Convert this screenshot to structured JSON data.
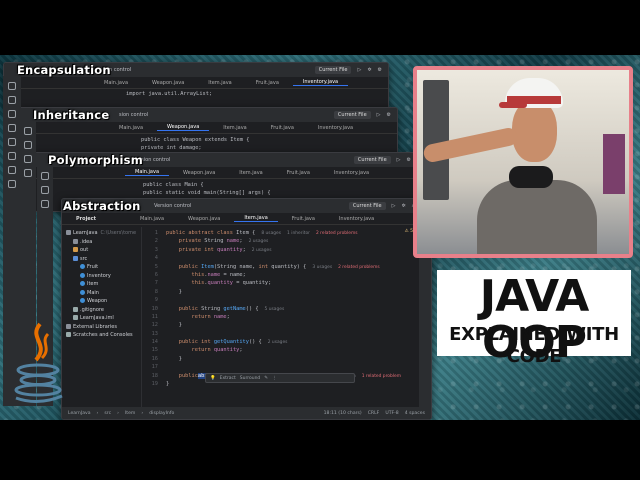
{
  "windows": [
    {
      "title": "Encapsulation",
      "version_control": "on control",
      "current_file": "Current File",
      "tabs": [
        "Main.java",
        "Weapon.java",
        "Item.java",
        "Fruit.java",
        "Inventory.java"
      ],
      "active_tab": 4,
      "code": [
        "import java.util.ArrayList;"
      ]
    },
    {
      "title": "Inheritance",
      "version_control": "sion control",
      "current_file": "Current File",
      "tabs": [
        "Main.java",
        "Weapon.java",
        "Item.java",
        "Fruit.java",
        "Inventory.java"
      ],
      "active_tab": 1,
      "code": [
        "public class Weapon extends Item {",
        "    private int damage;"
      ]
    },
    {
      "title": "Polymorphism",
      "version_control": "Version control",
      "current_file": "Current File",
      "tabs": [
        "Main.java",
        "Weapon.java",
        "Item.java",
        "Fruit.java",
        "Inventory.java"
      ],
      "active_tab": 0,
      "code": [
        "public class Main {",
        "    public static void main(String[] args) {"
      ]
    }
  ],
  "main_ide": {
    "title": "Abstraction",
    "project_label": "Project",
    "version_control": "Version control",
    "current_file": "Current File",
    "tabs": [
      "Main.java",
      "Weapon.java",
      "Item.java",
      "Fruit.java",
      "Inventory.java"
    ],
    "active_tab": 2,
    "tree": [
      {
        "label": "LearnJava",
        "suffix": "C:\\Users\\tome",
        "indent": 0,
        "icon": "folder"
      },
      {
        "label": ".idea",
        "indent": 1,
        "icon": "folder"
      },
      {
        "label": "out",
        "indent": 1,
        "icon": "folder orange"
      },
      {
        "label": "src",
        "indent": 1,
        "icon": "folder blue"
      },
      {
        "label": "Fruit",
        "indent": 2,
        "icon": "cls"
      },
      {
        "label": "Inventory",
        "indent": 2,
        "icon": "cls"
      },
      {
        "label": "Item",
        "indent": 2,
        "icon": "cls"
      },
      {
        "label": "Main",
        "indent": 2,
        "icon": "cls"
      },
      {
        "label": "Weapon",
        "indent": 2,
        "icon": "cls"
      },
      {
        "label": ".gitignore",
        "indent": 1,
        "icon": "file"
      },
      {
        "label": "LearnJava.iml",
        "indent": 1,
        "icon": "file"
      },
      {
        "label": "External Libraries",
        "indent": 0,
        "icon": "folder"
      },
      {
        "label": "Scratches and Consoles",
        "indent": 0,
        "icon": "file"
      }
    ],
    "line_numbers": [
      "1",
      "2",
      "3",
      "4",
      "5",
      "6",
      "7",
      "8",
      "9",
      "10",
      "11",
      "12",
      "13",
      "14",
      "15",
      "16",
      "17",
      "18",
      "19"
    ],
    "hints": {
      "class_usages": "8 usages",
      "inheritors": "1 inheritor",
      "related_problems": "2 related problems",
      "field_usages": "2 usages",
      "ctor_usages": "3 usages",
      "getname_usages": "5 usages",
      "getqty_usages": "2 usages",
      "display_usage": "1 usage",
      "display_impl": "1 implementation",
      "display_problem": "1 related problem"
    },
    "popup": {
      "extract": "Extract",
      "surround": "Surround"
    },
    "warning_count": "5",
    "status": {
      "breadcrumb": [
        "LearnJava",
        "src",
        "Item",
        "displayInfo"
      ],
      "position": "18:11 (10 chars)",
      "line_sep": "CRLF",
      "encoding": "UTF-8",
      "indent": "4 spaces"
    }
  },
  "thumbnail": {
    "title_line1": "JAVA OOP",
    "title_line2": "EXPLAINED WITH CODE"
  },
  "colors": {
    "ide_bg": "#1e1f22",
    "keyword": "#cf8e6d",
    "function": "#56a8f5",
    "field": "#c77dbb",
    "cam_border": "#e8808a"
  }
}
